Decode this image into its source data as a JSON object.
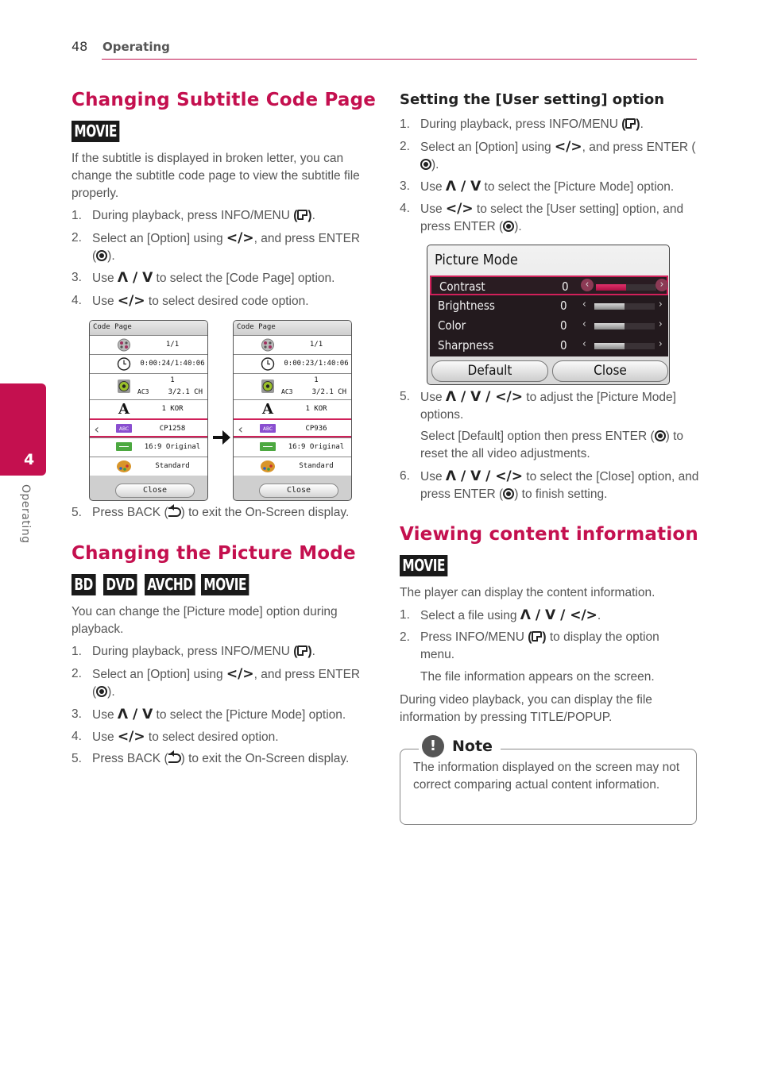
{
  "header": {
    "page_number": "48",
    "section": "Operating"
  },
  "side_tab": {
    "number": "4",
    "label": "Operating",
    "color": "#c4104f"
  },
  "left": {
    "subtitle_section": {
      "title": "Changing Subtitle Code Page",
      "badges": [
        "MOVIE"
      ],
      "intro": "If the subtitle is displayed in broken letter, you can change the subtitle code page to view the subtitle file properly.",
      "steps": [
        {
          "n": "1.",
          "pre": "During playback, press INFO/MENU ",
          "post": "."
        },
        {
          "n": "2.",
          "pre": "Select an [Option] using ",
          "arrows": "</>",
          "mid": ", and press ENTER (",
          "post": ")."
        },
        {
          "n": "3.",
          "pre": "Use ",
          "arrows": "Λ / V",
          "post": " to select the [Code Page] option."
        },
        {
          "n": "4.",
          "pre": "Use ",
          "arrows": "</>",
          "post": " to select desired code option."
        },
        {
          "n": "5.",
          "pre": "Press BACK (",
          "post": ") to exit the On-Screen display."
        }
      ],
      "screens": [
        {
          "title": "Code Page",
          "title_no": "1/1",
          "time": "0:00:24/1:40:06",
          "audio_track": "1",
          "audio_codec": "AC3",
          "audio_channels": "3/2.1 CH",
          "subtitle": "1 KOR",
          "code_page": "CP1258",
          "aspect": "16:9 Original",
          "picture_mode": "Standard",
          "close": "Close"
        },
        {
          "title": "Code Page",
          "title_no": "1/1",
          "time": "0:00:23/1:40:06",
          "audio_track": "1",
          "audio_codec": "AC3",
          "audio_channels": "3/2.1 CH",
          "subtitle": "1 KOR",
          "code_page": "CP936",
          "aspect": "16:9 Original",
          "picture_mode": "Standard",
          "close": "Close"
        }
      ]
    },
    "picture_section": {
      "title": "Changing the Picture Mode",
      "badges": [
        "BD",
        "DVD",
        "AVCHD",
        "MOVIE"
      ],
      "intro": "You can change the [Picture mode] option during playback.",
      "steps": [
        {
          "n": "1.",
          "pre": "During playback, press INFO/MENU ",
          "post": "."
        },
        {
          "n": "2.",
          "pre": "Select an [Option] using ",
          "arrows": "</>",
          "mid": ", and press ENTER (",
          "post": ")."
        },
        {
          "n": "3.",
          "pre": "Use ",
          "arrows": "Λ / V",
          "post": " to select the [Picture Mode] option."
        },
        {
          "n": "4.",
          "pre": "Use ",
          "arrows": "</>",
          "post": " to select desired option."
        },
        {
          "n": "5.",
          "pre": "Press BACK (",
          "post": ") to exit the On-Screen display."
        }
      ]
    }
  },
  "right": {
    "user_setting": {
      "title": "Setting the [User setting] option",
      "steps": [
        {
          "n": "1.",
          "pre": "During playback, press INFO/MENU ",
          "post": "."
        },
        {
          "n": "2.",
          "pre": "Select an [Option] using ",
          "arrows": "</>",
          "mid": ", and press ENTER (",
          "post": ")."
        },
        {
          "n": "3.",
          "pre": "Use ",
          "arrows": "Λ / V",
          "post": " to select the [Picture Mode] option."
        },
        {
          "n": "4.",
          "pre": "Use ",
          "arrows": "</>",
          "mid": " to select the [User setting] option, and press ENTER (",
          "post": ")."
        },
        {
          "n": "5.",
          "pre": "Use ",
          "arrows": "Λ / V / </>",
          "post": " to adjust the [Picture Mode] options."
        },
        {
          "n": "",
          "pre": "Select [Default] option then press ENTER (",
          "post": ") to reset the all video adjustments."
        },
        {
          "n": "6.",
          "pre": "Use ",
          "arrows": "Λ / V / </>",
          "mid": " to select the [Close] option, and press ENTER (",
          "post": ") to finish setting."
        }
      ],
      "dialog": {
        "title": "Picture Mode",
        "rows": [
          {
            "label": "Contrast",
            "value": "0",
            "level": 0.5,
            "selected": true
          },
          {
            "label": "Brightness",
            "value": "0",
            "level": 0.5,
            "selected": false
          },
          {
            "label": "Color",
            "value": "0",
            "level": 0.5,
            "selected": false
          },
          {
            "label": "Sharpness",
            "value": "0",
            "level": 0.5,
            "selected": false
          }
        ],
        "default_button": "Default",
        "close_button": "Close",
        "accent": "#d0205a"
      }
    },
    "content_info": {
      "title": "Viewing content information",
      "badges": [
        "MOVIE"
      ],
      "intro": "The player can display the content information.",
      "steps": [
        {
          "n": "1.",
          "pre": "Select a file using ",
          "arrows": "Λ / V / </>",
          "post": "."
        },
        {
          "n": "2.",
          "pre": "Press INFO/MENU ",
          "post": " to display the option menu."
        },
        {
          "n": "",
          "pre": "The file information appears on the screen.",
          "post": ""
        }
      ],
      "outro": "During video playback, you can display the file information by pressing TITLE/POPUP."
    },
    "note": {
      "label": "Note",
      "icon": "!",
      "text": "The information displayed on the screen may not correct comparing actual content information."
    }
  }
}
